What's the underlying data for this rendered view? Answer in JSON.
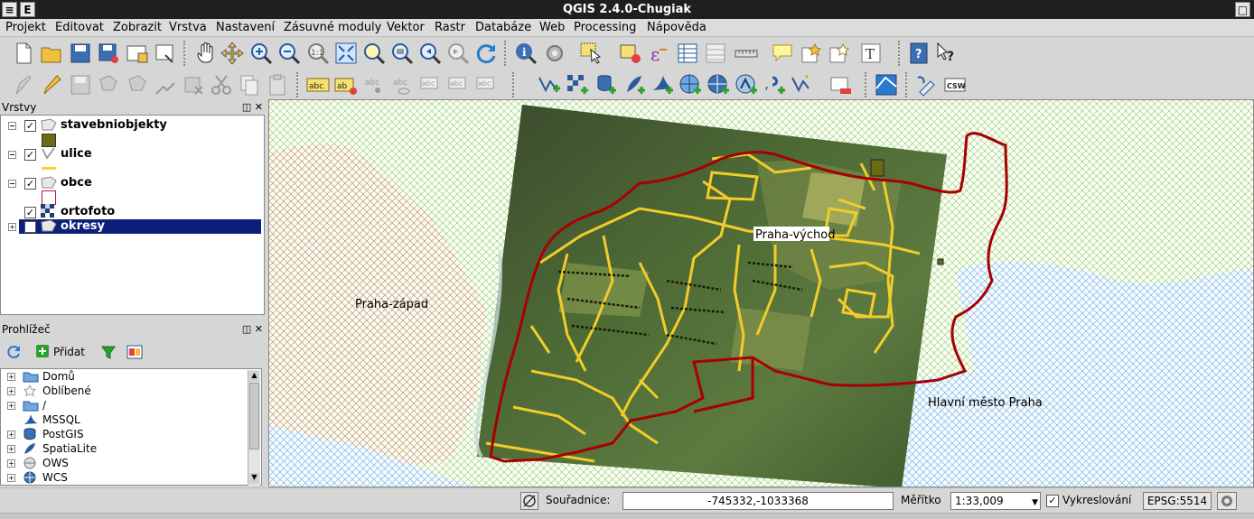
{
  "window": {
    "title": "QGIS 2.4.0-Chugiak",
    "left_button": "E"
  },
  "menu": [
    "Projekt",
    "Editovat",
    "Zobrazit",
    "Vrstva",
    "Nastavení",
    "Zásuvné moduly",
    "Vektor",
    "Rastr",
    "Databáze",
    "Web",
    "Processing",
    "Nápověda"
  ],
  "layers_panel": {
    "title": "Vrstvy",
    "items": [
      {
        "name": "stavebniobjekty",
        "checked": true,
        "symbol_color": "#6b6b14"
      },
      {
        "name": "ulice",
        "checked": true,
        "symbol_color": "#f5d132"
      },
      {
        "name": "obce",
        "checked": true,
        "symbol_color": "#c8102e"
      },
      {
        "name": "ortofoto",
        "checked": true
      },
      {
        "name": "okresy",
        "checked": true,
        "selected": true
      }
    ]
  },
  "browser_panel": {
    "title": "Prohlížeč",
    "add_label": "Přidat",
    "items": [
      "Domů",
      "Oblíbené",
      "/",
      "MSSQL",
      "PostGIS",
      "SpatiaLite",
      "OWS",
      "WCS"
    ]
  },
  "map": {
    "labels": {
      "west": "Praha-západ",
      "east": "Praha-východ",
      "south": "Hlavní město Praha"
    },
    "colors": {
      "boundary": "#a80000",
      "roads": "#f2cc2a",
      "hatch_green": "#7ab648",
      "hatch_blue": "#3a8fd0",
      "hatch_brown": "#8c6b3f"
    }
  },
  "status": {
    "coord_label": "Souřadnice:",
    "coord_value": "-745332,-1033368",
    "scale_label": "Měřítko",
    "scale_value": "1:33,009",
    "render_label": "Vykreslování",
    "render_checked": true,
    "crs": "EPSG:5514"
  }
}
